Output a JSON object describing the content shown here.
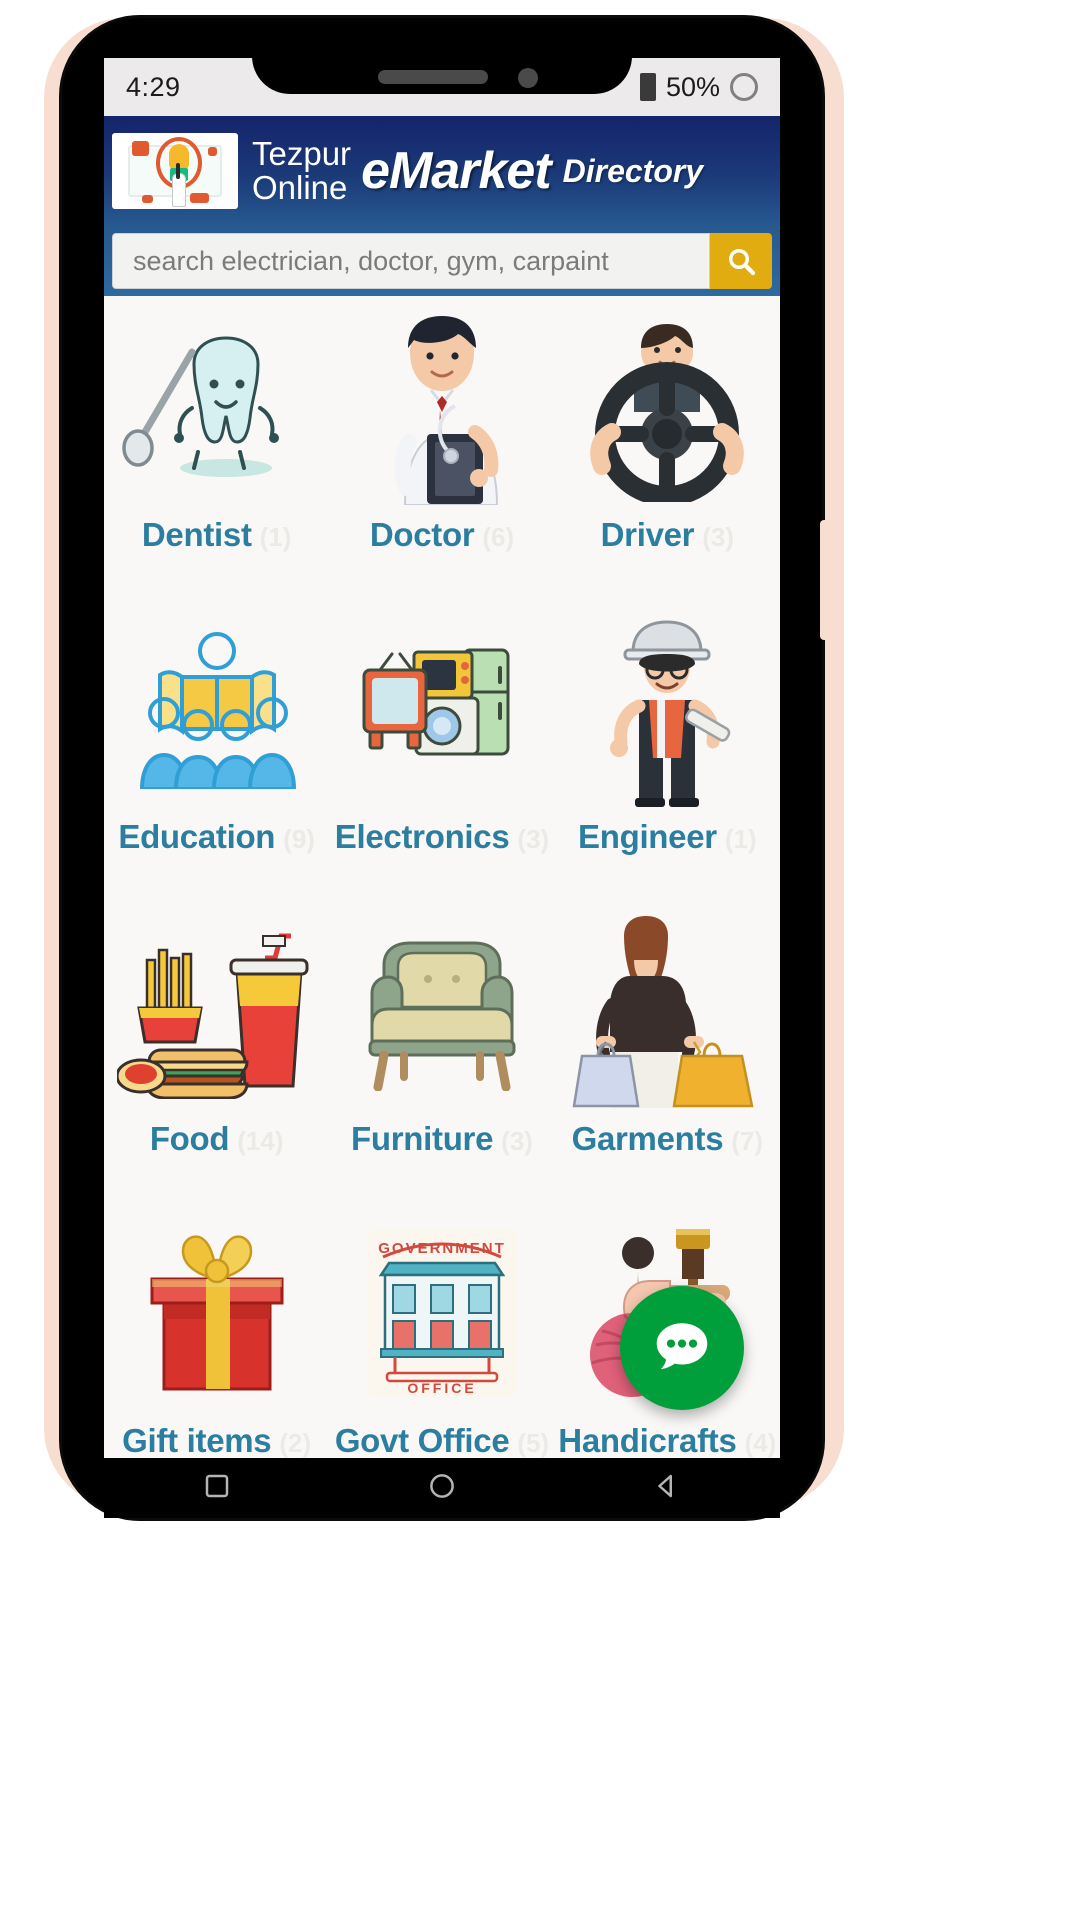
{
  "status_bar": {
    "time": "4:29",
    "battery_percent": "50%",
    "battery_icon": "battery-icon",
    "loading_icon": "circle-progress-icon"
  },
  "header": {
    "logo_icon": "app-logo-icon",
    "brand_line1": "Tezpur",
    "brand_line2": "Online",
    "brand_main": "eMarket",
    "brand_sub": "Directory",
    "bg_color": "#1b3a78"
  },
  "search": {
    "placeholder": "search electrician, doctor, gym, carpaint",
    "value": "",
    "button_icon": "search-icon",
    "button_color": "#e0ac10"
  },
  "categories": [
    {
      "name": "Dentist",
      "count": "(1)",
      "icon": "tooth-icon"
    },
    {
      "name": "Doctor",
      "count": "(6)",
      "icon": "doctor-icon"
    },
    {
      "name": "Driver",
      "count": "(3)",
      "icon": "steering-wheel-icon"
    },
    {
      "name": "Education",
      "count": "(9)",
      "icon": "students-reading-icon"
    },
    {
      "name": "Electronics",
      "count": "(3)",
      "icon": "home-appliances-icon"
    },
    {
      "name": "Engineer",
      "count": "(1)",
      "icon": "engineer-icon"
    },
    {
      "name": "Food",
      "count": "(14)",
      "icon": "fast-food-icon"
    },
    {
      "name": "Furniture",
      "count": "(3)",
      "icon": "armchair-icon"
    },
    {
      "name": "Garments",
      "count": "(7)",
      "icon": "clothing-shopper-icon"
    },
    {
      "name": "Gift items",
      "count": "(2)",
      "icon": "gift-box-icon"
    },
    {
      "name": "Govt Office",
      "count": "(5)",
      "icon": "government-office-icon"
    },
    {
      "name": "Handicrafts",
      "count": "(4)",
      "icon": "handicraft-yarn-icon"
    }
  ],
  "fab": {
    "icon": "chat-bubble-icon",
    "color": "#009f3c"
  },
  "nav_bar": {
    "recents_icon": "square-icon",
    "home_icon": "circle-icon",
    "back_icon": "triangle-back-icon"
  },
  "label_color": "#2c7ea1"
}
